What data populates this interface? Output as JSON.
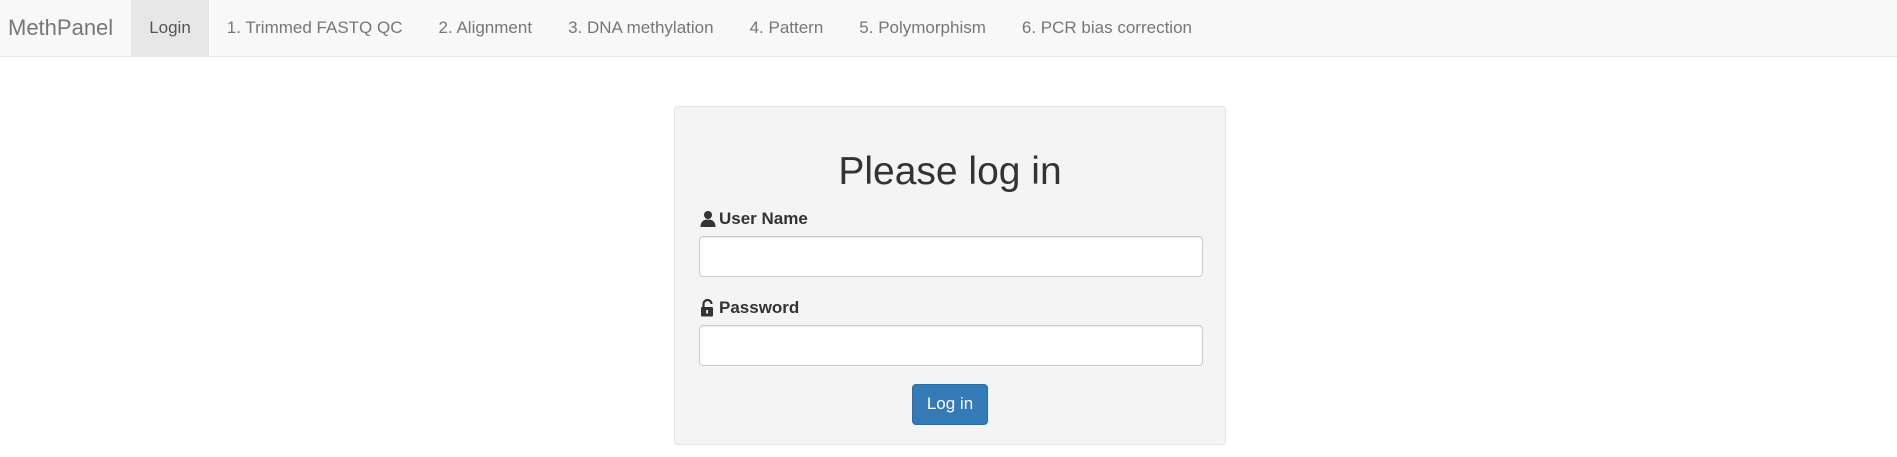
{
  "navbar": {
    "brand": "MethPanel",
    "items": [
      {
        "label": "Login",
        "active": true
      },
      {
        "label": "1. Trimmed FASTQ QC"
      },
      {
        "label": "2. Alignment"
      },
      {
        "label": "3. DNA methylation"
      },
      {
        "label": "4. Pattern"
      },
      {
        "label": "5. Polymorphism"
      },
      {
        "label": "6. PCR bias correction"
      }
    ]
  },
  "login": {
    "title": "Please log in",
    "username_label": "User Name",
    "username_icon": "user-icon",
    "username_value": "",
    "password_label": "Password",
    "password_icon": "unlock-icon",
    "password_value": "",
    "submit_label": "Log in"
  },
  "colors": {
    "navbar_bg": "#f8f8f8",
    "active_tab_bg": "#e7e7e7",
    "panel_bg": "#f4f4f4",
    "primary_button": "#337ab7"
  }
}
